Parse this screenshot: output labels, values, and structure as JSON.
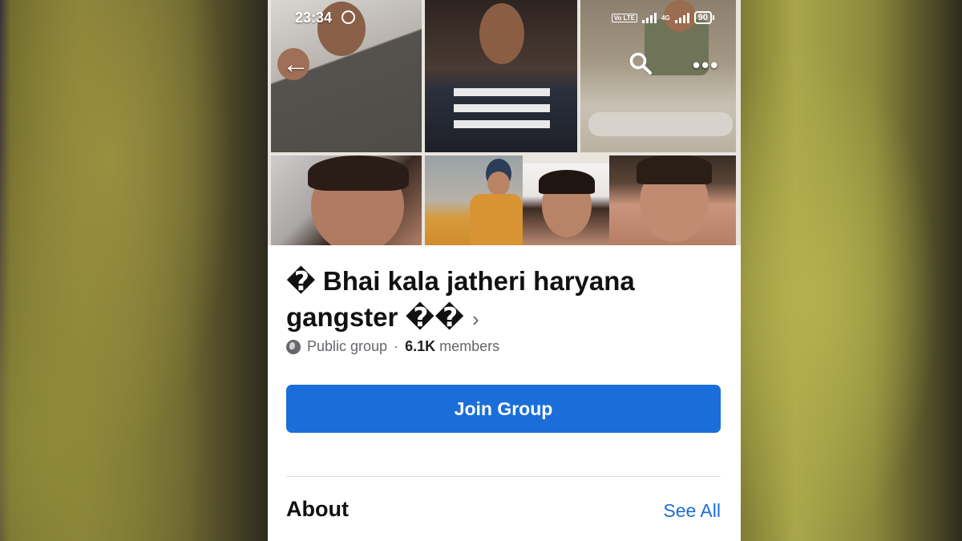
{
  "status_bar": {
    "time": "23:34",
    "volte": "Vo LTE",
    "network": "4G",
    "battery": "90"
  },
  "icons": {
    "back": "back-arrow-icon",
    "search": "search-icon",
    "more": "more-icon",
    "alarm": "alarm-icon",
    "globe": "globe-icon",
    "chevron": "chevron-right-icon"
  },
  "group": {
    "title": "� Bhai kala jatheri haryana gangster ��",
    "privacy": "Public group",
    "separator": "·",
    "member_count": "6.1K",
    "member_label": "members"
  },
  "actions": {
    "join_label": "Join Group"
  },
  "about": {
    "heading": "About",
    "see_all": "See All"
  },
  "colors": {
    "accent": "#1b6ed9",
    "secondary_text": "#65676b"
  }
}
